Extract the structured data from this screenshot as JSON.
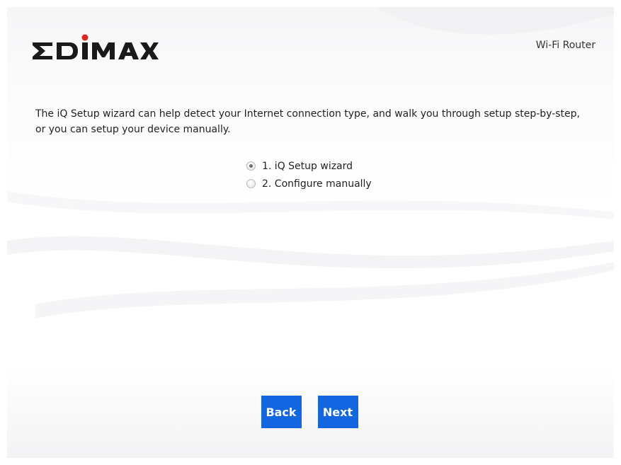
{
  "header": {
    "brand": "EDIMAX",
    "product_label": "Wi-Fi Router"
  },
  "main": {
    "description": "The iQ Setup wizard can help detect your Internet connection type, and walk you through setup step-by-step, or you can setup your device manually.",
    "options": [
      {
        "label": "1. iQ Setup wizard",
        "selected": true
      },
      {
        "label": "2. Configure manually",
        "selected": false
      }
    ]
  },
  "footer": {
    "back_label": "Back",
    "next_label": "Next"
  },
  "colors": {
    "button": "#1266e0",
    "brand_dot": "#d9261c",
    "brand_text": "#1a1a1a"
  },
  "icons": {
    "option_1": "radio-checked-icon",
    "option_2": "radio-unchecked-icon"
  }
}
